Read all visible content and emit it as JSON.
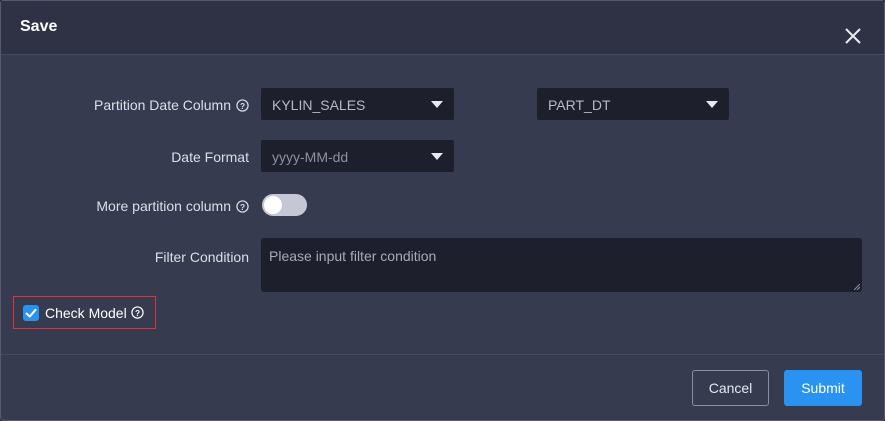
{
  "dialog": {
    "title": "Save",
    "close_icon": "close-icon"
  },
  "form": {
    "partition_label": "Partition Date Column",
    "partition_table": "KYLIN_SALES",
    "partition_column": "PART_DT",
    "date_format_label": "Date Format",
    "date_format_placeholder": "yyyy-MM-dd",
    "more_partition_label": "More partition column",
    "more_partition_enabled": false,
    "filter_label": "Filter Condition",
    "filter_placeholder": "Please input filter condition",
    "check_model_label": "Check Model",
    "check_model_checked": true
  },
  "footer": {
    "cancel_label": "Cancel",
    "submit_label": "Submit"
  },
  "colors": {
    "accent": "#2a93f2",
    "highlight_border": "#e0303b",
    "background": "#373b50"
  }
}
